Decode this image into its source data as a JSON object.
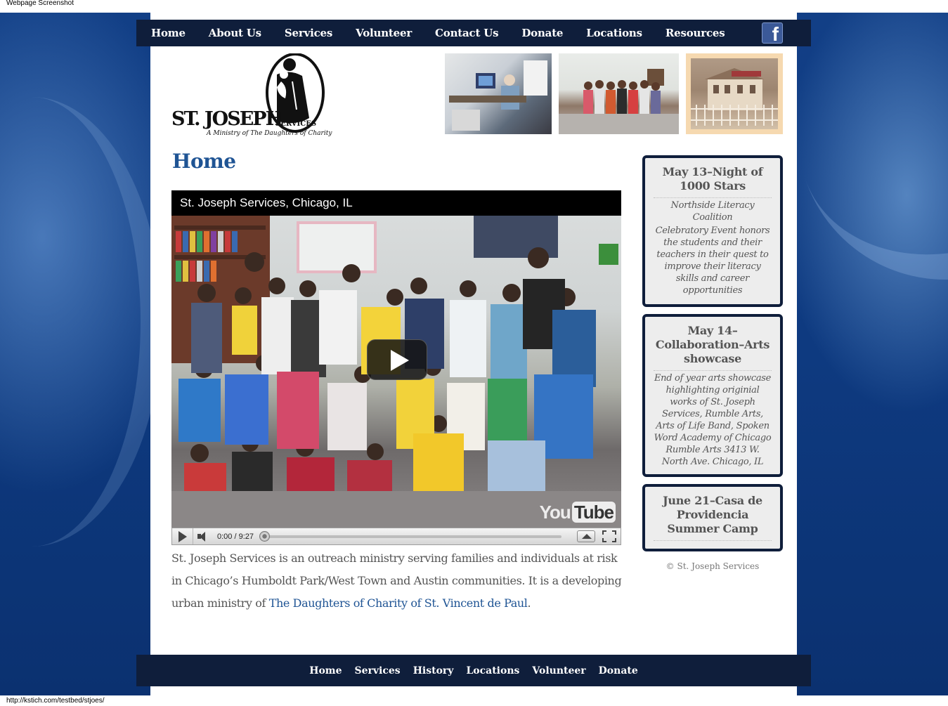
{
  "window": {
    "caption": "Webpage Screenshot",
    "status_url": "http://kstich.com/testbed/stjoes/"
  },
  "nav": {
    "items": [
      {
        "label": "Home"
      },
      {
        "label": "About Us"
      },
      {
        "label": "Services"
      },
      {
        "label": "Volunteer"
      },
      {
        "label": "Contact Us"
      },
      {
        "label": "Donate"
      },
      {
        "label": "Locations"
      },
      {
        "label": "Resources"
      }
    ],
    "facebook_icon": "f"
  },
  "logo": {
    "name_main": "ST. JOSEPH",
    "name_sub": "SERVICES",
    "tagline": "A Ministry of The Daughters of Charity"
  },
  "page": {
    "title": "Home"
  },
  "video": {
    "title": "St. Joseph Services, Chicago, IL",
    "time": "0:00 / 9:27",
    "progress": 0,
    "logo_you": "You",
    "logo_tube": "Tube"
  },
  "intro": {
    "text": "St. Joseph Services is an outreach ministry serving families and individuals at risk in Chicago’s Humboldt Park/West Town and Austin communities. It is a developing urban ministry of ",
    "link_text": "The Daughters of Charity of St. Vincent de Paul",
    "end": "."
  },
  "events": [
    {
      "title": "May 13–Night of 1000 Stars",
      "lines": [
        "Northside Literacy Coalition",
        "Celebratory Event honors the students and their teachers in their quest to improve their literacy skills and career opportunities"
      ]
    },
    {
      "title": "May 14–Collaboration–Arts showcase",
      "lines": [
        "End of year arts showcase highlighting originial works of St. Joseph Services, Rumble Arts, Arts of Life Band, Spoken Word Academy of Chicago Rumble Arts 3413 W. North Ave. Chicago, IL"
      ]
    },
    {
      "title": "June 21–Casa de Providencia Summer Camp",
      "lines": []
    }
  ],
  "copyright": "© St. Joseph Services",
  "footer": {
    "items": [
      {
        "label": "Home"
      },
      {
        "label": "Services"
      },
      {
        "label": "History"
      },
      {
        "label": "Locations"
      },
      {
        "label": "Volunteer"
      },
      {
        "label": "Donate"
      }
    ]
  },
  "colors": {
    "nav_bg": "#0f1e3b",
    "title_blue": "#1f5494",
    "body_text": "#555555",
    "backdrop_blue": "#0e3a80"
  }
}
